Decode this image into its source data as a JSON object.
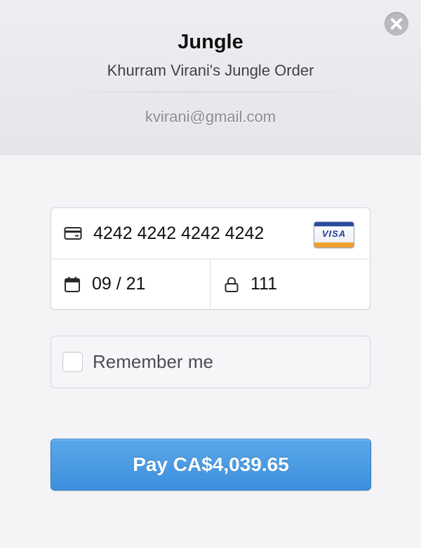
{
  "header": {
    "title": "Jungle",
    "subtitle": "Khurram Virani's Jungle Order",
    "email": "kvirani@gmail.com",
    "close_icon": "close-icon"
  },
  "card": {
    "number": "4242 4242 4242 4242",
    "brand": "VISA",
    "expiry": "09 / 21",
    "cvc": "111",
    "icons": {
      "number": "credit-card-icon",
      "expiry": "calendar-icon",
      "cvc": "lock-icon"
    }
  },
  "remember": {
    "label": "Remember me",
    "checked": false
  },
  "pay_button": {
    "label": "Pay CA$4,039.65"
  },
  "colors": {
    "pay_button": "#4a9be4",
    "header_bg": "#e8eaed",
    "body_bg": "#f4f4f6"
  }
}
